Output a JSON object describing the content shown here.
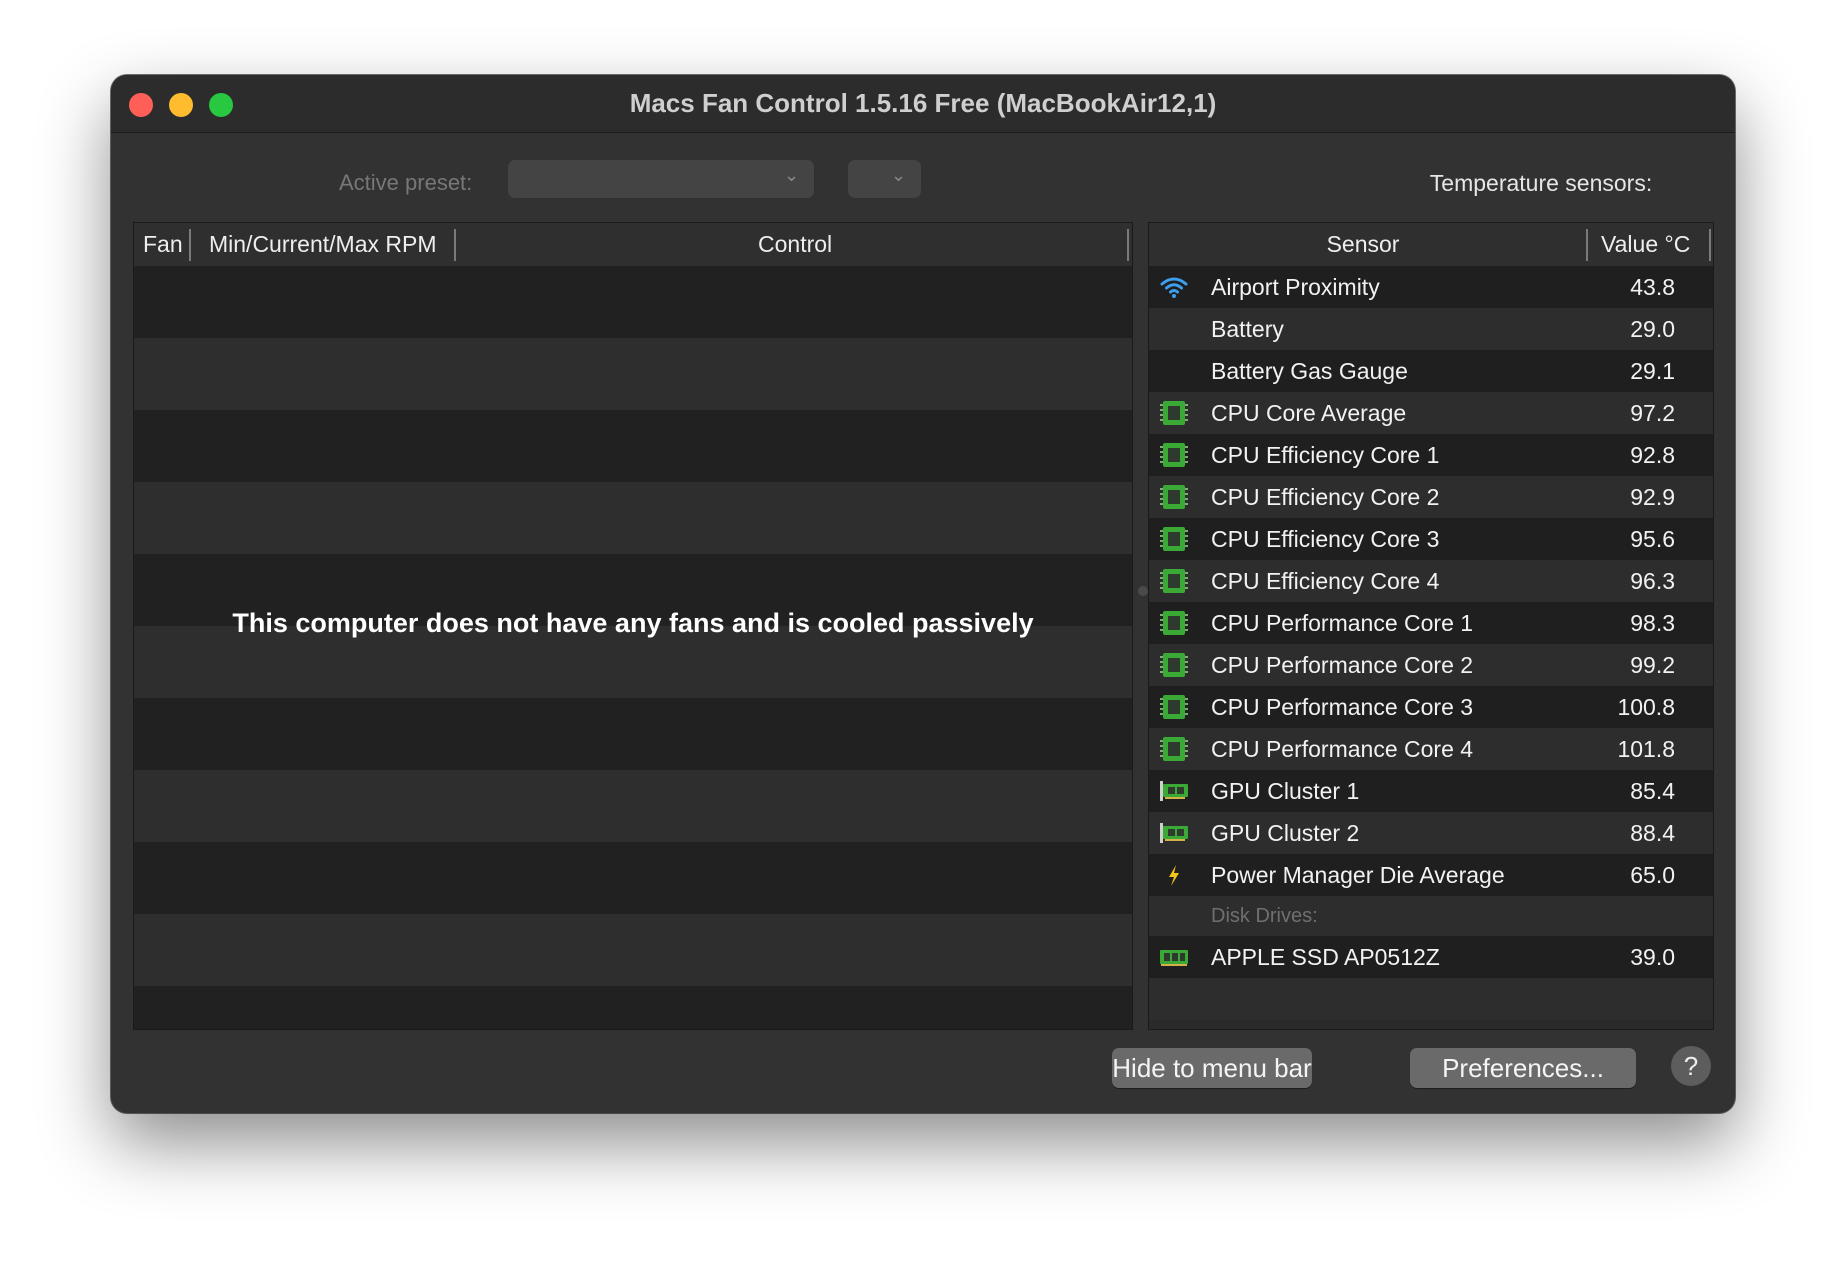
{
  "window": {
    "title": "Macs Fan Control 1.5.16 Free (MacBookAir12,1)"
  },
  "preset": {
    "label": "Active preset:",
    "selected": ""
  },
  "fan_table": {
    "columns": [
      "Fan",
      "Min/Current/Max RPM",
      "Control"
    ],
    "empty_message": "This computer does not have any fans and is cooled passively"
  },
  "sensors": {
    "caption": "Temperature sensors:",
    "columns": [
      "Sensor",
      "Value °C"
    ],
    "rows": [
      {
        "name": "Airport Proximity",
        "value": "43.8",
        "icon": "wifi-icon"
      },
      {
        "name": "Battery",
        "value": "29.0",
        "icon": ""
      },
      {
        "name": "Battery Gas Gauge",
        "value": "29.1",
        "icon": ""
      },
      {
        "name": "CPU Core Average",
        "value": "97.2",
        "icon": "cpu-chip-icon"
      },
      {
        "name": "CPU Efficiency Core 1",
        "value": "92.8",
        "icon": "cpu-chip-icon"
      },
      {
        "name": "CPU Efficiency Core 2",
        "value": "92.9",
        "icon": "cpu-chip-icon"
      },
      {
        "name": "CPU Efficiency Core 3",
        "value": "95.6",
        "icon": "cpu-chip-icon"
      },
      {
        "name": "CPU Efficiency Core 4",
        "value": "96.3",
        "icon": "cpu-chip-icon"
      },
      {
        "name": "CPU Performance Core 1",
        "value": "98.3",
        "icon": "cpu-chip-icon"
      },
      {
        "name": "CPU Performance Core 2",
        "value": "99.2",
        "icon": "cpu-chip-icon"
      },
      {
        "name": "CPU Performance Core 3",
        "value": "100.8",
        "icon": "cpu-chip-icon"
      },
      {
        "name": "CPU Performance Core 4",
        "value": "101.8",
        "icon": "cpu-chip-icon"
      },
      {
        "name": "GPU Cluster 1",
        "value": "85.4",
        "icon": "gpu-card-icon"
      },
      {
        "name": "GPU Cluster 2",
        "value": "88.4",
        "icon": "gpu-card-icon"
      },
      {
        "name": "Power Manager Die Average",
        "value": "65.0",
        "icon": "lightning-icon"
      }
    ],
    "disk_section_label": "Disk Drives:",
    "disk_rows": [
      {
        "name": "APPLE SSD AP0512Z",
        "value": "39.0",
        "icon": "ssd-drive-icon"
      }
    ]
  },
  "buttons": {
    "hide_label": "Hide to menu bar",
    "preferences_label": "Preferences...",
    "help_label": "?"
  },
  "colors": {
    "window_bg": "#323232",
    "chip_green": "#3aa935",
    "wifi_blue": "#3b9ff0",
    "lightning_yellow": "#f5c518"
  }
}
